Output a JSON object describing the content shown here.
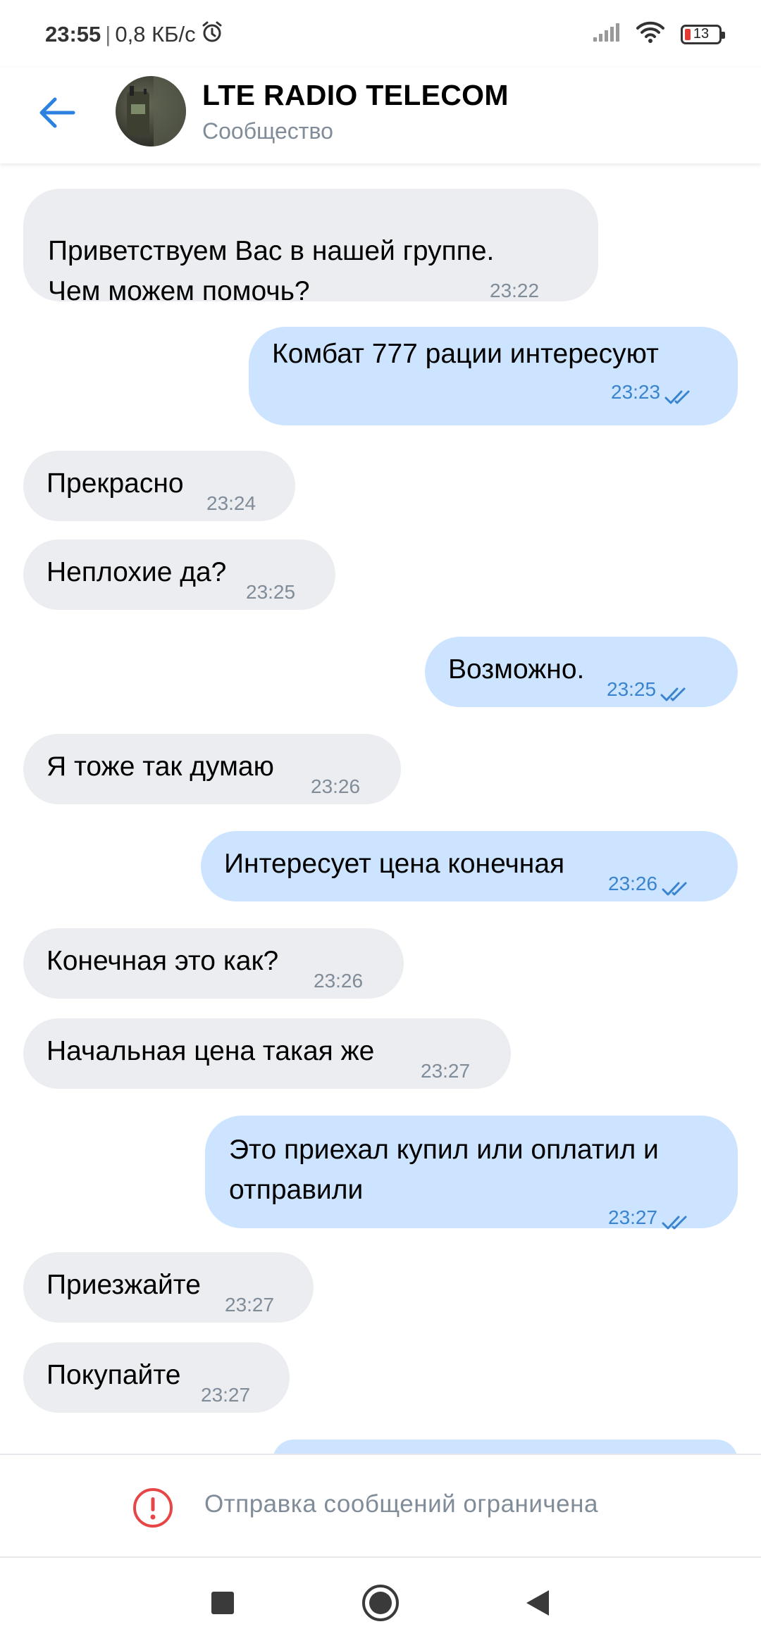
{
  "status_bar": {
    "time": "23:55",
    "speed": "0,8 КБ/с",
    "battery": "13",
    "alarm_icon": "alarm-icon",
    "signal_icon": "signal-icon",
    "wifi_icon": "wifi-icon"
  },
  "header": {
    "title": "LTE RADIO TELECOM",
    "subtitle": "Сообщество",
    "back_icon": "back-arrow-icon"
  },
  "messages": [
    {
      "dir": "in",
      "text": "Приветствуем Вас в нашей группе.\nЧем можем помочь?",
      "time": "23:22"
    },
    {
      "dir": "out",
      "text": "Комбат 777 рации интересуют",
      "time": "23:23",
      "read": true
    },
    {
      "dir": "in",
      "text": "Прекрасно",
      "time": "23:24"
    },
    {
      "dir": "in",
      "text": "Неплохие да?",
      "time": "23:25"
    },
    {
      "dir": "out",
      "text": "Возможно.",
      "time": "23:25",
      "read": true
    },
    {
      "dir": "in",
      "text": "Я тоже так думаю",
      "time": "23:26"
    },
    {
      "dir": "out",
      "text": "Интересует цена конечная",
      "time": "23:26",
      "read": true
    },
    {
      "dir": "in",
      "text": "Конечная это как?",
      "time": "23:26"
    },
    {
      "dir": "in",
      "text": "Начальная цена такая же",
      "time": "23:27"
    },
    {
      "dir": "out",
      "text": "Это приехал купил или оплатил и\nотправили",
      "time": "23:27",
      "read": true
    },
    {
      "dir": "in",
      "text": "Приезжайте",
      "time": "23:27"
    },
    {
      "dir": "in",
      "text": "Покупайте",
      "time": "23:27"
    }
  ],
  "restricted": {
    "text": "Отправка сообщений ограничена",
    "icon": "exclamation-circle-icon",
    "color": "#e64646"
  },
  "nav": {
    "recents_icon": "square-icon",
    "home_icon": "circle-icon",
    "back_icon": "triangle-back-icon"
  },
  "colors": {
    "incoming_bubble": "#ebedf0",
    "outgoing_bubble": "#cce4ff",
    "accent": "#3a84cf",
    "secondary_text": "#818c99"
  }
}
